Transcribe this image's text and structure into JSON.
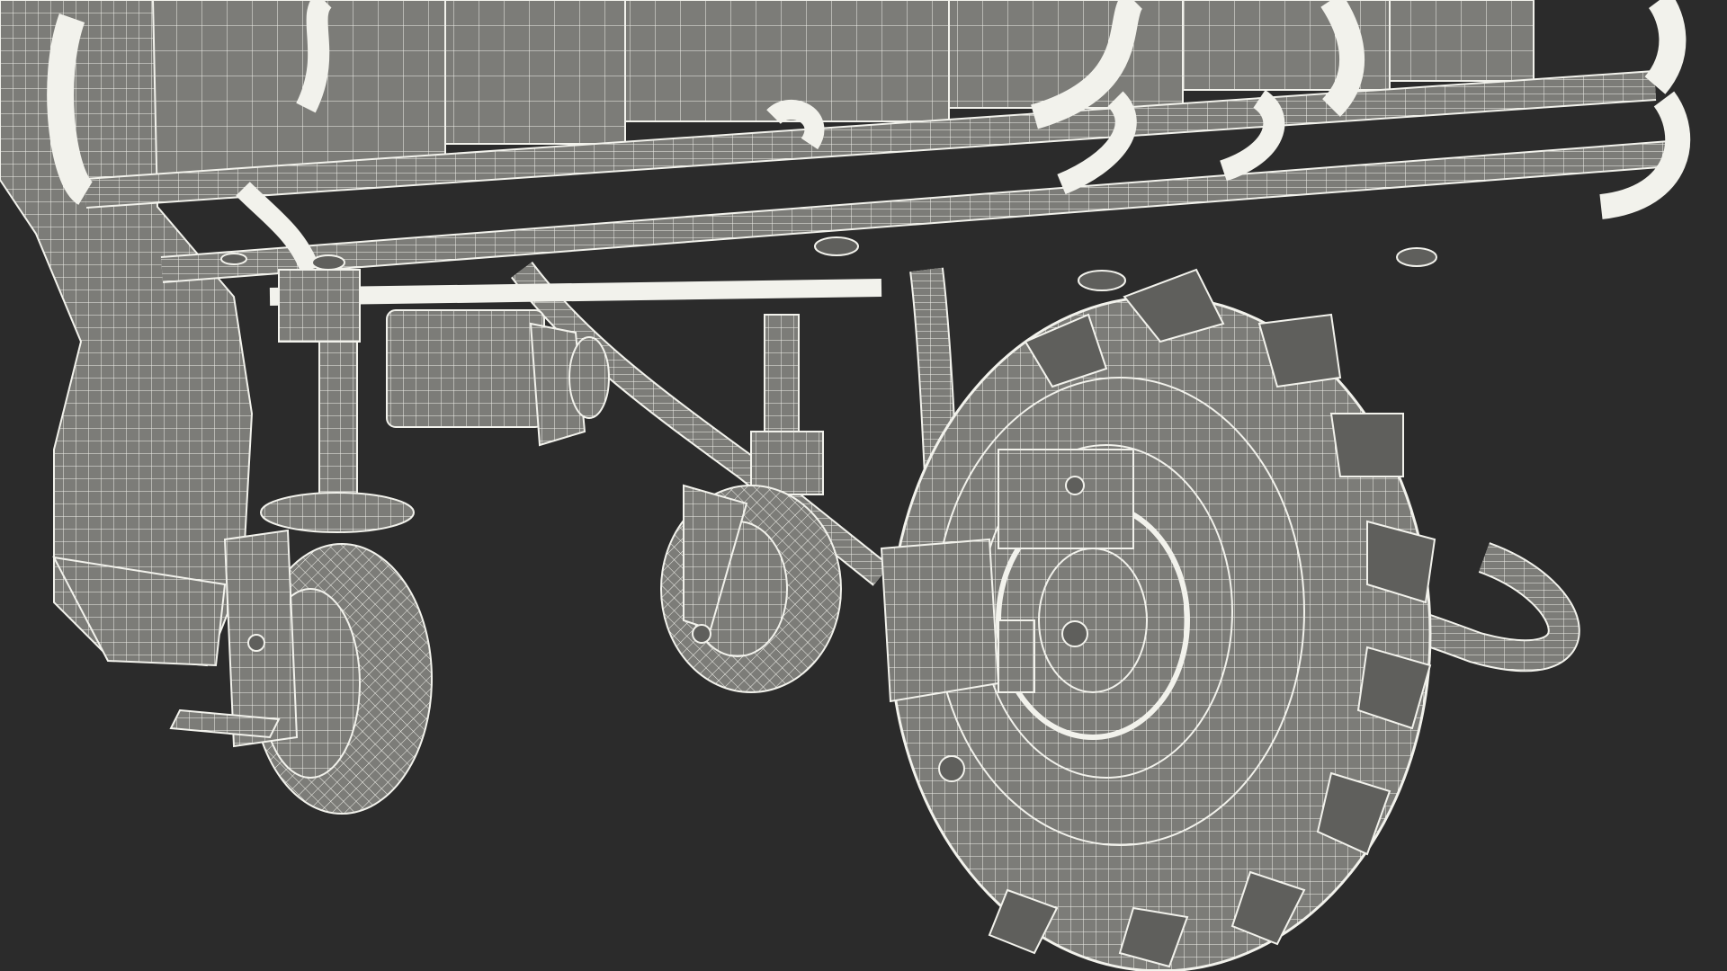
{
  "render": {
    "background_color": "#2b2b2b",
    "mesh_fill": "#7c7c78",
    "mesh_fill_dark": "#5f5f5c",
    "wire_color": "#f2f2ec"
  },
  "model": {
    "subject": "wireframe-3d-model",
    "parts": [
      "cargo-bed",
      "tube-frame",
      "caster-wheel-front",
      "caster-wheel-middle",
      "drive-wheel",
      "disc-brake",
      "motor",
      "leg-with-boot"
    ]
  }
}
